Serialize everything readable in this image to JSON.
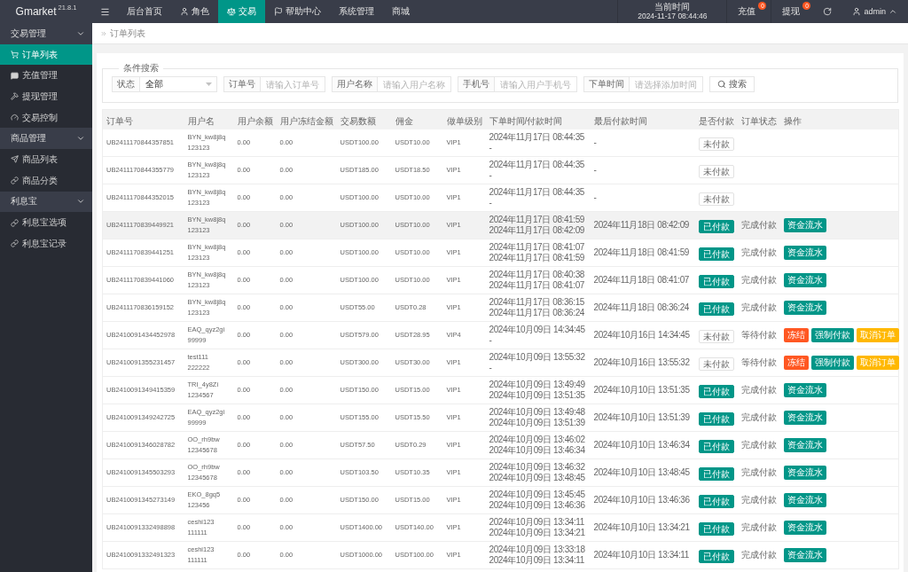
{
  "topbar": {
    "logo": "Gmarket",
    "version": "21.8.1",
    "nav": [
      {
        "label": "后台首页",
        "selected": false
      },
      {
        "label": "角色",
        "selected": false
      },
      {
        "label": "交易",
        "selected": true
      },
      {
        "label": "帮助中心",
        "selected": false
      },
      {
        "label": "系统管理",
        "selected": false
      },
      {
        "label": "商城",
        "selected": false
      }
    ],
    "clock": {
      "label": "当前时间",
      "value": "2024-11-17 08:44:46"
    },
    "counters": [
      {
        "label": "充值",
        "badge": "0"
      },
      {
        "label": "提现",
        "badge": "0"
      }
    ],
    "user": "admin"
  },
  "sidebar": {
    "groups": [
      {
        "label": "交易管理",
        "expanded": true,
        "items": [
          {
            "label": "订单列表",
            "selected": true
          },
          {
            "label": "充值管理",
            "selected": false
          },
          {
            "label": "提现管理",
            "selected": false
          },
          {
            "label": "交易控制",
            "selected": false
          }
        ]
      },
      {
        "label": "商品管理",
        "expanded": true,
        "items": [
          {
            "label": "商品列表",
            "selected": false
          },
          {
            "label": "商品分类",
            "selected": false
          }
        ]
      },
      {
        "label": "利息宝",
        "expanded": true,
        "items": [
          {
            "label": "利息宝选项",
            "selected": false
          },
          {
            "label": "利息宝记录",
            "selected": false
          }
        ]
      }
    ]
  },
  "breadcrumb": {
    "current": "订单列表"
  },
  "filters": {
    "legend": "条件搜索",
    "status": {
      "label": "状态",
      "value": "全部"
    },
    "fields": [
      {
        "label": "订单号",
        "placeholder": "请输入订单号"
      },
      {
        "label": "用户名称",
        "placeholder": "请输入用户名称"
      },
      {
        "label": "手机号",
        "placeholder": "请输入用户手机号"
      },
      {
        "label": "下单时间",
        "placeholder": "请选择添加时间"
      }
    ],
    "search_button": "搜索"
  },
  "table": {
    "columns": [
      "订单号",
      "用户名",
      "用户余额",
      "用户冻结金额",
      "交易数额",
      "佣金",
      "做单级别",
      "下单时间/付款时间",
      "最后付款时间",
      "是否付款",
      "订单状态",
      "操作"
    ],
    "rows": [
      {
        "order_no": "UB2411170844357851",
        "user": [
          "BYN_kw8j8q",
          "123123"
        ],
        "balance": "0.00",
        "frozen": "0.00",
        "amount": "USDT100.00",
        "commission": "USDT10.00",
        "vip": "VIP1",
        "order_time": "2024年11月17日 08:44:35",
        "pay_time": "-",
        "last_pay_time": "-",
        "payment": {
          "label": "未付款",
          "paid": false
        },
        "highlighted": false
      },
      {
        "order_no": "UB2411170844355779",
        "user": [
          "BYN_kw8j8q",
          "123123"
        ],
        "balance": "0.00",
        "frozen": "0.00",
        "amount": "USDT185.00",
        "commission": "USDT18.50",
        "vip": "VIP1",
        "order_time": "2024年11月17日 08:44:35",
        "pay_time": "-",
        "last_pay_time": "-",
        "payment": {
          "label": "未付款",
          "paid": false
        },
        "highlighted": false
      },
      {
        "order_no": "UB2411170844352015",
        "user": [
          "BYN_kw8j8q",
          "123123"
        ],
        "balance": "0.00",
        "frozen": "0.00",
        "amount": "USDT100.00",
        "commission": "USDT10.00",
        "vip": "VIP1",
        "order_time": "2024年11月17日 08:44:35",
        "pay_time": "-",
        "last_pay_time": "-",
        "payment": {
          "label": "未付款",
          "paid": false
        },
        "highlighted": false
      },
      {
        "order_no": "UB2411170839449921",
        "user": [
          "BYN_kw8j8q",
          "123123"
        ],
        "balance": "0.00",
        "frozen": "0.00",
        "amount": "USDT100.00",
        "commission": "USDT10.00",
        "vip": "VIP1",
        "order_time": "2024年11月17日 08:41:59",
        "pay_time": "2024年11月17日 08:42:09",
        "last_pay_time": "2024年11月18日 08:42:09",
        "payment": {
          "label": "已付款",
          "paid": true
        },
        "status": "完成付款",
        "actions": [
          {
            "label": "资金流水",
            "kind": "primary"
          }
        ],
        "highlighted": true
      },
      {
        "order_no": "UB2411170839441251",
        "user": [
          "BYN_kw8j8q",
          "123123"
        ],
        "balance": "0.00",
        "frozen": "0.00",
        "amount": "USDT100.00",
        "commission": "USDT10.00",
        "vip": "VIP1",
        "order_time": "2024年11月17日 08:41:07",
        "pay_time": "2024年11月17日 08:41:59",
        "last_pay_time": "2024年11月18日 08:41:59",
        "payment": {
          "label": "已付款",
          "paid": true
        },
        "status": "完成付款",
        "actions": [
          {
            "label": "资金流水",
            "kind": "primary"
          }
        ],
        "highlighted": false
      },
      {
        "order_no": "UB2411170839441060",
        "user": [
          "BYN_kw8j8q",
          "123123"
        ],
        "balance": "0.00",
        "frozen": "0.00",
        "amount": "USDT100.00",
        "commission": "USDT10.00",
        "vip": "VIP1",
        "order_time": "2024年11月17日 08:40:38",
        "pay_time": "2024年11月17日 08:41:07",
        "last_pay_time": "2024年11月18日 08:41:07",
        "payment": {
          "label": "已付款",
          "paid": true
        },
        "status": "完成付款",
        "actions": [
          {
            "label": "资金流水",
            "kind": "primary"
          }
        ],
        "highlighted": false
      },
      {
        "order_no": "UB2411170836159152",
        "user": [
          "BYN_kw8j8q",
          "123123"
        ],
        "balance": "0.00",
        "frozen": "0.00",
        "amount": "USDT55.00",
        "commission": "USDT0.28",
        "vip": "VIP1",
        "order_time": "2024年11月17日 08:36:15",
        "pay_time": "2024年11月17日 08:36:24",
        "last_pay_time": "2024年11月18日 08:36:24",
        "payment": {
          "label": "已付款",
          "paid": true
        },
        "status": "完成付款",
        "actions": [
          {
            "label": "资金流水",
            "kind": "primary"
          }
        ],
        "highlighted": false
      },
      {
        "order_no": "UB2410091434452978",
        "user": [
          "EAQ_qyz2gi",
          "99999"
        ],
        "balance": "0.00",
        "frozen": "0.00",
        "amount": "USDT579.00",
        "commission": "USDT28.95",
        "vip": "VIP4",
        "order_time": "2024年10月09日 14:34:45",
        "pay_time": "-",
        "last_pay_time": "2024年10月16日 14:34:45",
        "payment": {
          "label": "未付款",
          "paid": false
        },
        "status": "等待付款",
        "actions": [
          {
            "label": "冻结",
            "kind": "danger"
          },
          {
            "label": "强制付款",
            "kind": "primary"
          },
          {
            "label": "取消订单",
            "kind": "warning"
          }
        ],
        "highlighted": false
      },
      {
        "order_no": "UB2410091355231457",
        "user": [
          "test111",
          "222222"
        ],
        "balance": "0.00",
        "frozen": "0.00",
        "amount": "USDT300.00",
        "commission": "USDT30.00",
        "vip": "VIP1",
        "order_time": "2024年10月09日 13:55:32",
        "pay_time": "-",
        "last_pay_time": "2024年10月16日 13:55:32",
        "payment": {
          "label": "未付款",
          "paid": false
        },
        "status": "等待付款",
        "actions": [
          {
            "label": "冻结",
            "kind": "danger"
          },
          {
            "label": "强制付款",
            "kind": "primary"
          },
          {
            "label": "取消订单",
            "kind": "warning"
          }
        ],
        "highlighted": false
      },
      {
        "order_no": "UB2410091349415359",
        "user": [
          "TRI_4y8Zi",
          "1234567"
        ],
        "balance": "0.00",
        "frozen": "0.00",
        "amount": "USDT150.00",
        "commission": "USDT15.00",
        "vip": "VIP1",
        "order_time": "2024年10月09日 13:49:49",
        "pay_time": "2024年10月09日 13:51:35",
        "last_pay_time": "2024年10月10日 13:51:35",
        "payment": {
          "label": "已付款",
          "paid": true
        },
        "status": "完成付款",
        "actions": [
          {
            "label": "资金流水",
            "kind": "primary"
          }
        ],
        "highlighted": false
      },
      {
        "order_no": "UB2410091349242725",
        "user": [
          "EAQ_qyz2gi",
          "99999"
        ],
        "balance": "0.00",
        "frozen": "0.00",
        "amount": "USDT155.00",
        "commission": "USDT15.50",
        "vip": "VIP1",
        "order_time": "2024年10月09日 13:49:48",
        "pay_time": "2024年10月09日 13:51:39",
        "last_pay_time": "2024年10月10日 13:51:39",
        "payment": {
          "label": "已付款",
          "paid": true
        },
        "status": "完成付款",
        "actions": [
          {
            "label": "资金流水",
            "kind": "primary"
          }
        ],
        "highlighted": false
      },
      {
        "order_no": "UB2410091346028782",
        "user": [
          "OO_rh9bw",
          "12345678"
        ],
        "balance": "0.00",
        "frozen": "0.00",
        "amount": "USDT57.50",
        "commission": "USDT0.29",
        "vip": "VIP1",
        "order_time": "2024年10月09日 13:46:02",
        "pay_time": "2024年10月09日 13:46:34",
        "last_pay_time": "2024年10月10日 13:46:34",
        "payment": {
          "label": "已付款",
          "paid": true
        },
        "status": "完成付款",
        "actions": [
          {
            "label": "资金流水",
            "kind": "primary"
          }
        ],
        "highlighted": false
      },
      {
        "order_no": "UB2410091345503293",
        "user": [
          "OO_rh9bw",
          "12345678"
        ],
        "balance": "0.00",
        "frozen": "0.00",
        "amount": "USDT103.50",
        "commission": "USDT10.35",
        "vip": "VIP1",
        "order_time": "2024年10月09日 13:46:32",
        "pay_time": "2024年10月09日 13:48:45",
        "last_pay_time": "2024年10月10日 13:48:45",
        "payment": {
          "label": "已付款",
          "paid": true
        },
        "status": "完成付款",
        "actions": [
          {
            "label": "资金流水",
            "kind": "primary"
          }
        ],
        "highlighted": false
      },
      {
        "order_no": "UB2410091345273149",
        "user": [
          "EKO_8gq5",
          "123456"
        ],
        "balance": "0.00",
        "frozen": "0.00",
        "amount": "USDT150.00",
        "commission": "USDT15.00",
        "vip": "VIP1",
        "order_time": "2024年10月09日 13:45:45",
        "pay_time": "2024年10月09日 13:46:36",
        "last_pay_time": "2024年10月10日 13:46:36",
        "payment": {
          "label": "已付款",
          "paid": true
        },
        "status": "完成付款",
        "actions": [
          {
            "label": "资金流水",
            "kind": "primary"
          }
        ],
        "highlighted": false
      },
      {
        "order_no": "UB2410091332498898",
        "user": [
          "ceshi123",
          "111111"
        ],
        "balance": "0.00",
        "frozen": "0.00",
        "amount": "USDT1400.00",
        "commission": "USDT140.00",
        "vip": "VIP1",
        "order_time": "2024年10月09日 13:34:11",
        "pay_time": "2024年10月09日 13:34:21",
        "last_pay_time": "2024年10月10日 13:34:21",
        "payment": {
          "label": "已付款",
          "paid": true
        },
        "status": "完成付款",
        "actions": [
          {
            "label": "资金流水",
            "kind": "primary"
          }
        ],
        "highlighted": false
      },
      {
        "order_no": "UB2410091332491323",
        "user": [
          "ceshi123",
          "111111"
        ],
        "balance": "0.00",
        "frozen": "0.00",
        "amount": "USDT1000.00",
        "commission": "USDT100.00",
        "vip": "VIP1",
        "order_time": "2024年10月09日 13:33:18",
        "pay_time": "2024年10月09日 13:34:11",
        "last_pay_time": "2024年10月10日 13:34:11",
        "payment": {
          "label": "已付款",
          "paid": true
        },
        "status": "完成付款",
        "actions": [
          {
            "label": "资金流水",
            "kind": "primary"
          }
        ],
        "highlighted": false
      }
    ]
  }
}
